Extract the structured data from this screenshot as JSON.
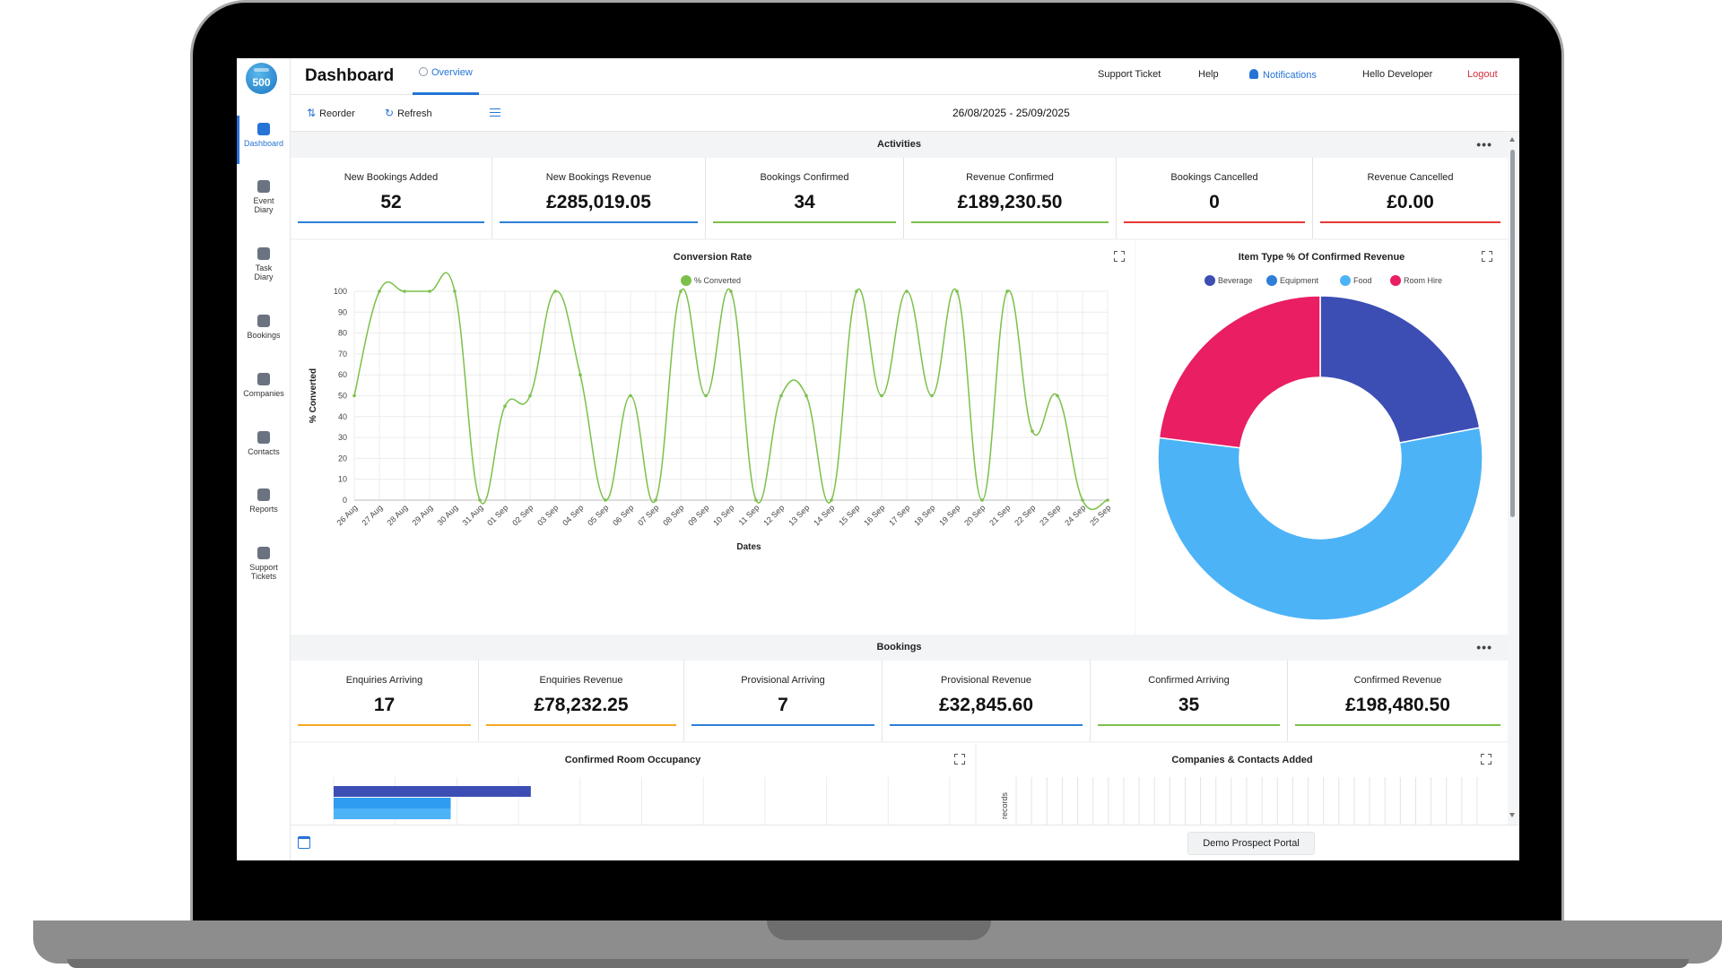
{
  "app": {
    "logo_text": "500"
  },
  "sidebar": {
    "items": [
      {
        "label": "Dashboard"
      },
      {
        "label": "Event Diary"
      },
      {
        "label": "Task Diary"
      },
      {
        "label": "Bookings"
      },
      {
        "label": "Companies"
      },
      {
        "label": "Contacts"
      },
      {
        "label": "Reports"
      },
      {
        "label": "Support Tickets"
      }
    ]
  },
  "header": {
    "title": "Dashboard",
    "tab": "Overview",
    "links": {
      "support": "Support Ticket",
      "help": "Help",
      "notifications": "Notifications",
      "user": "Hello Developer",
      "logout": "Logout"
    }
  },
  "toolbar": {
    "reorder": "Reorder",
    "refresh": "Refresh",
    "date_range": "26/08/2025 - 25/09/2025"
  },
  "activities": {
    "title": "Activities",
    "more": "•••",
    "kpis": [
      {
        "label": "New Bookings Added",
        "value": "52",
        "color": "#2e7fd8"
      },
      {
        "label": "New Bookings Revenue",
        "value": "£285,019.05",
        "color": "#2e7fd8"
      },
      {
        "label": "Bookings Confirmed",
        "value": "34",
        "color": "#7cc04b"
      },
      {
        "label": "Revenue Confirmed",
        "value": "£189,230.50",
        "color": "#7cc04b"
      },
      {
        "label": "Bookings Cancelled",
        "value": "0",
        "color": "#e53935"
      },
      {
        "label": "Revenue Cancelled",
        "value": "£0.00",
        "color": "#e53935"
      }
    ]
  },
  "bookings": {
    "title": "Bookings",
    "more": "•••",
    "kpis": [
      {
        "label": "Enquiries Arriving",
        "value": "17",
        "color": "#f5a623"
      },
      {
        "label": "Enquiries Revenue",
        "value": "£78,232.25",
        "color": "#f5a623"
      },
      {
        "label": "Provisional Arriving",
        "value": "7",
        "color": "#2e7fd8"
      },
      {
        "label": "Provisional Revenue",
        "value": "£32,845.60",
        "color": "#2e7fd8"
      },
      {
        "label": "Confirmed Arriving",
        "value": "35",
        "color": "#7cc04b"
      },
      {
        "label": "Confirmed Revenue",
        "value": "£198,480.50",
        "color": "#7cc04b"
      }
    ]
  },
  "panels": {
    "room_occupancy": "Confirmed Room Occupancy",
    "companies_contacts": "Companies & Contacts Added",
    "records_axis": "records"
  },
  "footer": {
    "demo_button": "Demo Prospect Portal"
  },
  "chart_data": [
    {
      "type": "line",
      "title": "Conversion Rate",
      "xlabel": "Dates",
      "ylabel": "% Converted",
      "ylim": [
        0,
        100
      ],
      "yticks": [
        0,
        10,
        20,
        30,
        40,
        50,
        60,
        70,
        80,
        90,
        100
      ],
      "grid": true,
      "legend": "top",
      "color": "#7cc04b",
      "categories": [
        "26 Aug",
        "27 Aug",
        "28 Aug",
        "29 Aug",
        "30 Aug",
        "31 Aug",
        "01 Sep",
        "02 Sep",
        "03 Sep",
        "04 Sep",
        "05 Sep",
        "06 Sep",
        "07 Sep",
        "08 Sep",
        "09 Sep",
        "10 Sep",
        "11 Sep",
        "12 Sep",
        "13 Sep",
        "14 Sep",
        "15 Sep",
        "16 Sep",
        "17 Sep",
        "18 Sep",
        "19 Sep",
        "20 Sep",
        "21 Sep",
        "22 Sep",
        "23 Sep",
        "24 Sep",
        "25 Sep"
      ],
      "series": [
        {
          "name": "% Converted",
          "values": [
            50,
            100,
            100,
            100,
            100,
            0,
            45,
            50,
            100,
            60,
            0,
            50,
            0,
            100,
            50,
            100,
            0,
            50,
            50,
            0,
            100,
            50,
            100,
            50,
            100,
            0,
            100,
            33,
            50,
            0,
            0
          ]
        }
      ]
    },
    {
      "type": "pie",
      "title": "Item Type % Of Confirmed Revenue",
      "legend": "top",
      "donut": true,
      "categories": [
        "Beverage",
        "Equipment",
        "Food",
        "Room Hire"
      ],
      "values": [
        22,
        0,
        55,
        23
      ],
      "colors": [
        "#3c4db4",
        "#2e7fd8",
        "#4db3f7",
        "#e91e63"
      ]
    },
    {
      "type": "bar",
      "title": "Confirmed Room Occupancy",
      "orientation": "horizontal",
      "values": [
        32,
        19,
        19
      ],
      "colors": [
        "#3c4db4",
        "#2e9cf0",
        "#4db3f7"
      ]
    }
  ]
}
